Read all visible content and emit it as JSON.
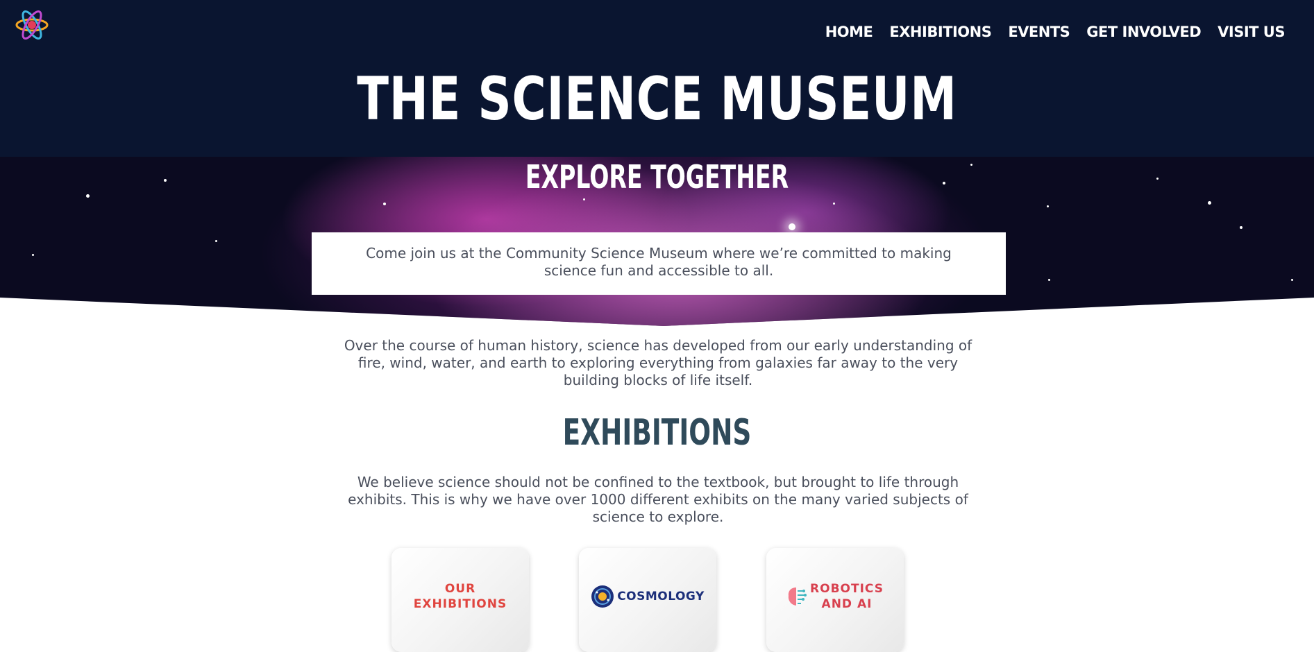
{
  "nav": {
    "items": [
      "HOME",
      "EXHIBITIONS",
      "EVENTS",
      "GET INVOLVED",
      "VISIT US"
    ]
  },
  "hero": {
    "title": "THE SCIENCE MUSEUM",
    "tagline": "EXPLORE TOGETHER",
    "intro": "Come join us at the Community Science Museum where we’re committed to making science fun and accessible to all."
  },
  "history": {
    "text": "Over the course of human history, science has developed from our early understanding of fire, wind, water, and earth to exploring everything from galaxies far away to the very building blocks of life itself."
  },
  "exhibitions": {
    "heading": "EXHIBITIONS",
    "text": "We believe science should not be confined to the textbook, but brought to life through exhibits. This is why we have over 1000 different exhibits on the many varied subjects of science to explore.",
    "cards": [
      {
        "label_line1": "OUR",
        "label_line2": "EXHIBITIONS",
        "color": "#e0453f"
      },
      {
        "label_line1": "COSMOLOGY",
        "color": "#1c2f7a",
        "icon": "planet-icon"
      },
      {
        "label_line1": "ROBOTICS",
        "label_line2": "AND AI",
        "color": "#d8404e",
        "icon": "brain-circuit-icon"
      }
    ]
  },
  "colors": {
    "header_bg": "#0a1530",
    "heading": "#2f4a5a",
    "body_text": "#4a4f5c"
  }
}
